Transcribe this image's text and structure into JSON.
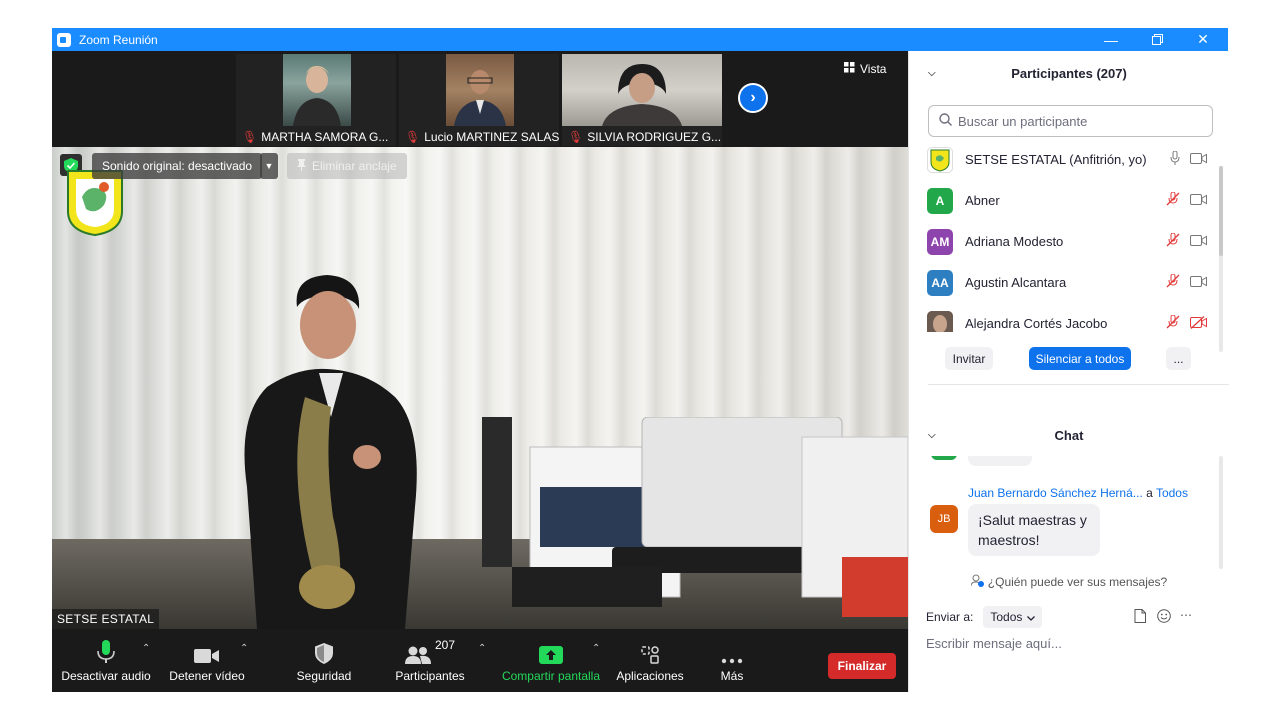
{
  "window": {
    "title": "Zoom Reunión"
  },
  "strip": {
    "thumbs": [
      {
        "name": "MARTHA SAMORA G..."
      },
      {
        "name": "Lucio MARTINEZ SALAS"
      },
      {
        "name": "SILVIA RODRIGUEZ G..."
      }
    ],
    "view_label": "Vista"
  },
  "video": {
    "sound_chip": "Sonido original: desactivado",
    "unpin_label": "Eliminar anclaje",
    "name_label": "SETSE ESTATAL"
  },
  "toolbar": {
    "mute_label": "Desactivar audio",
    "video_label": "Detener vídeo",
    "security_label": "Seguridad",
    "participants_label": "Participantes",
    "participants_count": "207",
    "share_label": "Compartir pantalla",
    "apps_label": "Aplicaciones",
    "more_label": "Más",
    "end_label": "Finalizar"
  },
  "participants_panel": {
    "title": "Participantes (207)",
    "search_placeholder": "Buscar un participante",
    "items": [
      {
        "name": "SETSE ESTATAL (Anfitrión, yo)",
        "initials": "",
        "color": "#ffffff"
      },
      {
        "name": "Abner",
        "initials": "A",
        "color": "#22a84a"
      },
      {
        "name": "Adriana Modesto",
        "initials": "AM",
        "color": "#8e44ad"
      },
      {
        "name": "Agustin Alcantara",
        "initials": "AA",
        "color": "#2d7fc1"
      },
      {
        "name": "Alejandra Cortés Jacobo",
        "initials": "",
        "color": "#a7897a"
      }
    ],
    "invite_label": "Invitar",
    "mute_all_label": "Silenciar a todos",
    "more_label": "..."
  },
  "chat": {
    "title": "Chat",
    "sender": "Juan Bernardo Sánchez Herná...",
    "to_prefix": "a",
    "to_target": "Todos",
    "sender_initials": "JB",
    "message": "¡Salut maestras y maestros!",
    "who_can_see": "¿Quién puede ver sus mensajes?",
    "send_to_label": "Enviar a:",
    "send_to_value": "Todos",
    "input_placeholder": "Escribir mensaje aquí..."
  },
  "colors": {
    "titlebar": "#1a8cff",
    "accent": "#0e72ed",
    "end": "#d42a2a",
    "share": "#23d959",
    "muted": "#e23b3b"
  }
}
